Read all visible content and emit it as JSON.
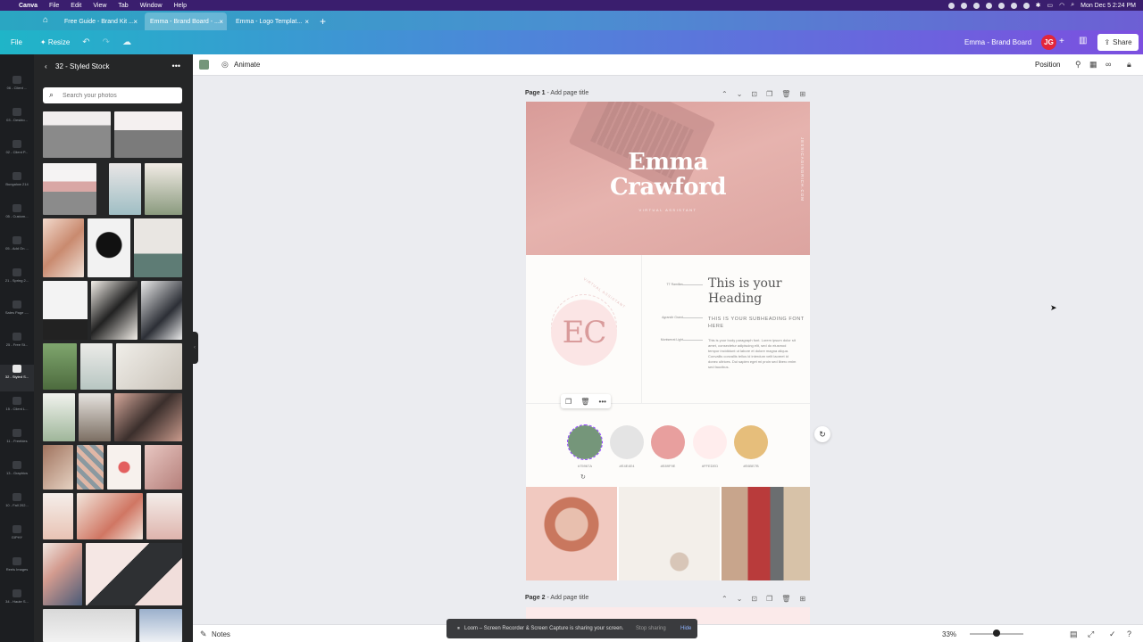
{
  "mac_menu": {
    "app": "Canva",
    "items": [
      "File",
      "Edit",
      "View",
      "Tab",
      "Window",
      "Help"
    ],
    "clock": "Mon Dec 5  2:24 PM"
  },
  "browser_tabs": [
    {
      "label": "Free Guide - Brand Kit ...",
      "active": false
    },
    {
      "label": "Emma - Brand Board - ...",
      "active": true
    },
    {
      "label": "Emma - Logo Templat...",
      "active": false
    }
  ],
  "header": {
    "file": "File",
    "resize": "Resize",
    "doc_title": "Emma - Brand Board",
    "avatar": "JG",
    "share": "Share"
  },
  "rail": {
    "items": [
      "06 - Client ...",
      "03 - Deskto...",
      "02 - Client P...",
      "Bungalow 214",
      "05 - Custom...",
      "05 - Add On ...",
      "21 - Spring 2...",
      "Sales Page -...",
      "25 - Free St...",
      "32 - Styled S...",
      "15 - Client L...",
      "11 - Freebies",
      "13 - Graphics",
      "10 - Fall 202...",
      "GIPHY",
      "Reels Images",
      "34 - Haute S..."
    ],
    "active_index": 9
  },
  "panel": {
    "title": "32 - Styled Stock",
    "search_placeholder": "Search your photos"
  },
  "toolbar": {
    "animate": "Animate",
    "position": "Position",
    "color": "#75967a"
  },
  "page1": {
    "label": "Page 1",
    "placeholder": "Add page title",
    "hero": {
      "name_line1": "Emma",
      "name_line2": "Crawford",
      "role": "VIRTUAL ASSISTANT",
      "website": "JESSICAGINGRICH.COM"
    },
    "logo": {
      "monogram": "EC",
      "ring_text": "VIRTUAL ASSISTANT"
    },
    "typography": {
      "fonts": [
        {
          "label": "TT Ramillas"
        },
        {
          "label": "Agrandir Grand"
        },
        {
          "label": "Montserrat Light"
        }
      ],
      "heading": "This is your Heading",
      "subheading": "THIS IS YOUR SUBHEADING FONT HERE",
      "paragraph": "This is your body paragraph font. Lorem ipsum dolor sit amet, consectetur adipiscing elit, sed do eiusmod tempor incididunt ut labore et dolore magna aliqua. Convallis convallis tellus id interdum velit laoreet id donec ultrices. Dui sapien eget mi proin sed libero enim sed faucibus."
    },
    "colors": [
      {
        "hex": "#75967A",
        "value": "#75967a"
      },
      {
        "hex": "#E4E4E4",
        "value": "#e4e4e4"
      },
      {
        "hex": "#E89F9E",
        "value": "#e89f9e"
      },
      {
        "hex": "#FFEDED",
        "value": "#ffeded"
      },
      {
        "hex": "#E6BE7B",
        "value": "#e6be7b"
      }
    ]
  },
  "page2": {
    "label": "Page 2",
    "placeholder": "Add page title"
  },
  "bottom": {
    "notes": "Notes",
    "zoom": "33%"
  },
  "loom": {
    "message": "Loom – Screen Recorder & Screen Capture is sharing your screen.",
    "stop": "Stop sharing",
    "hide": "Hide"
  }
}
